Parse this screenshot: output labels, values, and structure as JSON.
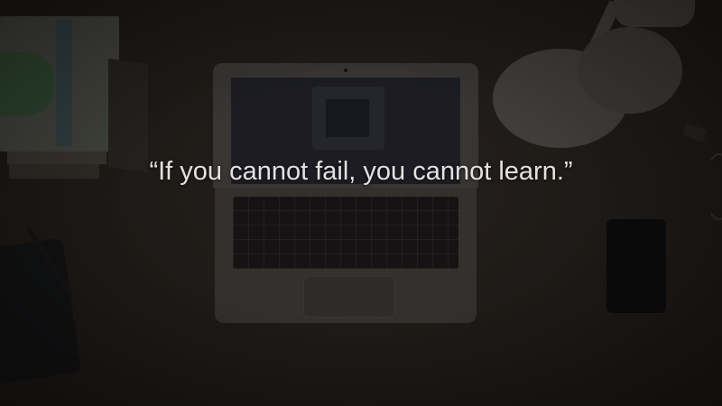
{
  "quote": {
    "text": "“If you cannot fail, you cannot learn.”"
  },
  "scene": {
    "background_color": "#2b2722",
    "text_color": "#e2e2e2",
    "objects": [
      "books-stack",
      "tablet",
      "pen",
      "laptop",
      "desk-lamp",
      "smartphone",
      "binder-clip"
    ]
  }
}
